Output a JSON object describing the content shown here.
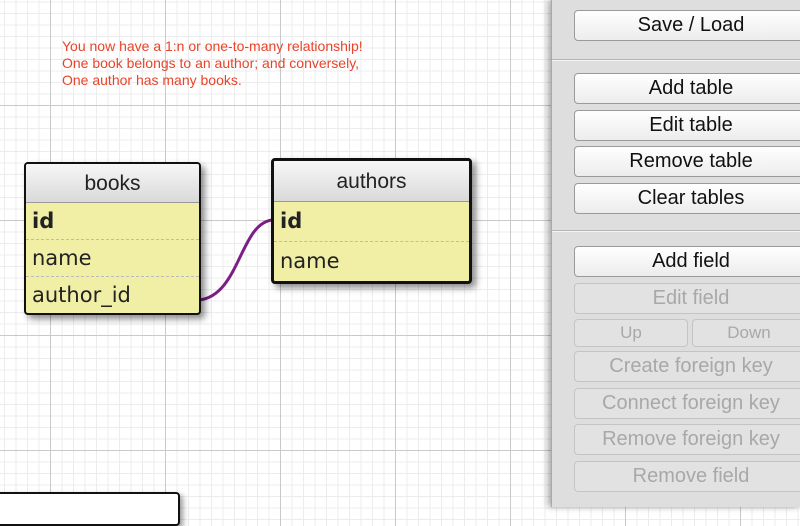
{
  "note": {
    "lines": [
      "You now have a 1:n or one-to-many relationship!",
      "One book belongs to an author; and conversely,",
      "One author has many books."
    ]
  },
  "tables": {
    "books": {
      "name": "books",
      "fields": [
        "id",
        "name",
        "author_id"
      ]
    },
    "authors": {
      "name": "authors",
      "fields": [
        "id",
        "name"
      ]
    }
  },
  "relation": {
    "from": "books.author_id",
    "to": "authors.id",
    "color": "#7b1f86"
  },
  "panel": {
    "save_load": "Save / Load",
    "add_table": "Add table",
    "edit_table": "Edit table",
    "remove_table": "Remove table",
    "clear_tables": "Clear tables",
    "add_field": "Add field",
    "edit_field": "Edit field",
    "up": "Up",
    "down": "Down",
    "create_fk": "Create foreign key",
    "connect_fk": "Connect foreign key",
    "remove_fk": "Remove foreign key",
    "remove_field": "Remove field"
  }
}
